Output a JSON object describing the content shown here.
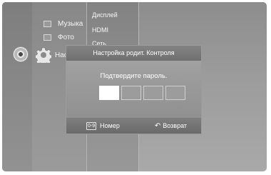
{
  "menu": {
    "items": [
      {
        "label": "Музыка",
        "icon": "music-icon"
      },
      {
        "label": "Фото",
        "icon": "photo-icon"
      },
      {
        "label": "Нас",
        "icon": "settings-gear-icon"
      }
    ]
  },
  "submenu": {
    "items": [
      "Дисплей",
      "HDMI",
      "Сеть"
    ]
  },
  "dialog": {
    "title": "Настройка родит. Контроля",
    "prompt": "Подтвердите пароль.",
    "pin_boxes": 4,
    "active_box": 1,
    "footer": {
      "number_key": "0-9",
      "number_label": "Номер",
      "return_label": "Возврат"
    }
  }
}
